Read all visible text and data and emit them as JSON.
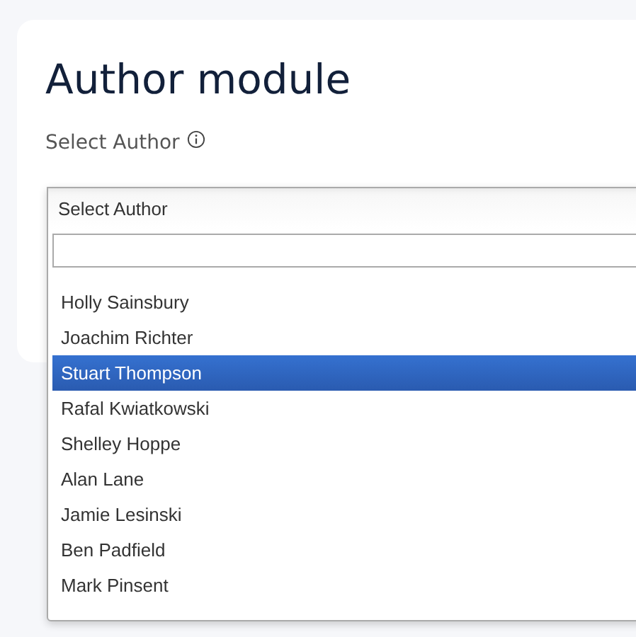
{
  "card": {
    "title": "Author module",
    "field_label": "Select Author"
  },
  "dropdown": {
    "header": "Select Author",
    "items": [
      {
        "label": "Holly Sainsbury",
        "selected": false
      },
      {
        "label": "Joachim Richter",
        "selected": false
      },
      {
        "label": "Stuart Thompson",
        "selected": true
      },
      {
        "label": "Rafal Kwiatkowski",
        "selected": false
      },
      {
        "label": "Shelley Hoppe",
        "selected": false
      },
      {
        "label": "Alan Lane",
        "selected": false
      },
      {
        "label": "Jamie Lesinski",
        "selected": false
      },
      {
        "label": "Ben Padfield",
        "selected": false
      },
      {
        "label": "Mark Pinsent",
        "selected": false
      }
    ]
  }
}
